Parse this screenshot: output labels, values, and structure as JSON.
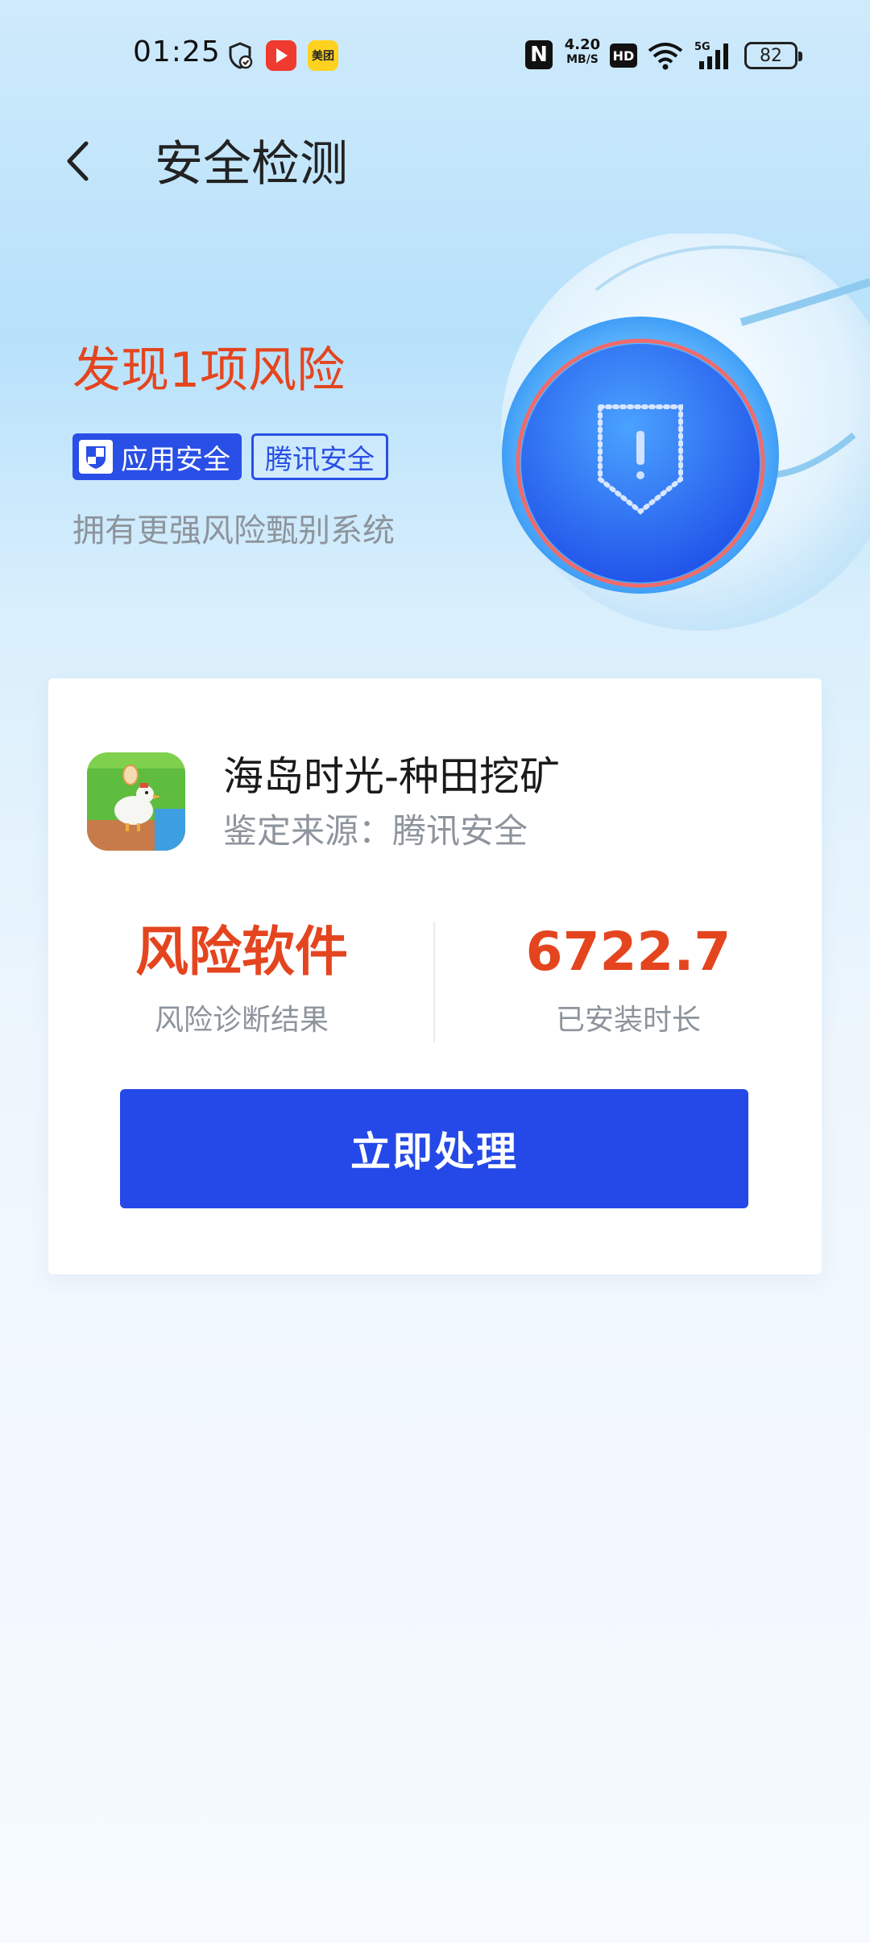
{
  "status_bar": {
    "time": "01:25",
    "net_speed_value": "4.20",
    "net_speed_unit": "MB/S",
    "hd_label": "HD",
    "network_label": "5G",
    "battery_level": "82",
    "meituan_label": "美团",
    "icons": [
      "shield-check-icon",
      "video-app-icon",
      "meituan-app-icon",
      "nfc-icon",
      "hd-icon",
      "wifi-icon",
      "signal-5g-icon",
      "battery-icon"
    ]
  },
  "header": {
    "title": "安全检测",
    "back_icon": "chevron-left-icon"
  },
  "hero": {
    "headline": "发现1项风险",
    "tags": [
      {
        "label": "应用安全",
        "icon": "shield-app-icon"
      },
      {
        "label": "腾讯安全"
      }
    ],
    "subtitle": "拥有更强风险甄别系统",
    "illustration": "shield-orb-icon"
  },
  "card": {
    "app_name": "海岛时光-种田挖矿",
    "source": "鉴定来源：腾讯安全",
    "stats": [
      {
        "value": "风险软件",
        "label": "风险诊断结果"
      },
      {
        "value": "6722.7",
        "label": "已安装时长"
      }
    ],
    "action_label": "立即处理"
  },
  "colors": {
    "accent": "#2449e8",
    "risk": "#e4451f",
    "muted_text": "#8d949c"
  }
}
